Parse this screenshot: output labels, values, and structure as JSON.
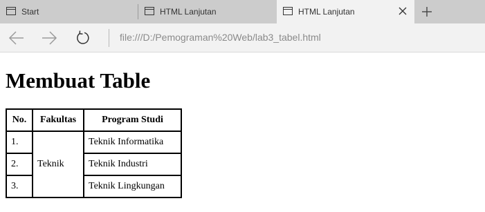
{
  "browser": {
    "tabs": [
      {
        "label": "Start",
        "active": false
      },
      {
        "label": "HTML Lanjutan",
        "active": false
      },
      {
        "label": "HTML Lanjutan",
        "active": true
      }
    ],
    "address": "file:///D:/Pemograman%20Web/lab3_tabel.html",
    "icons": {
      "back": "arrow-left-icon",
      "forward": "arrow-right-icon",
      "refresh": "refresh-icon",
      "tab": "tab-page-icon",
      "close": "close-icon",
      "new_tab": "plus-icon"
    }
  },
  "page": {
    "heading": "Membuat Table",
    "table": {
      "headers": [
        "No.",
        "Fakultas",
        "Program Studi"
      ],
      "faculty": "Teknik",
      "rows": [
        {
          "no": "1.",
          "program": "Teknik Informatika"
        },
        {
          "no": "2.",
          "program": "Teknik Industri"
        },
        {
          "no": "3.",
          "program": "Teknik Lingkungan"
        }
      ]
    }
  },
  "colors": {
    "tabstrip_bg": "#cccccc",
    "active_tab_bg": "#f2f2f2",
    "address_text": "#8a8a8a"
  }
}
